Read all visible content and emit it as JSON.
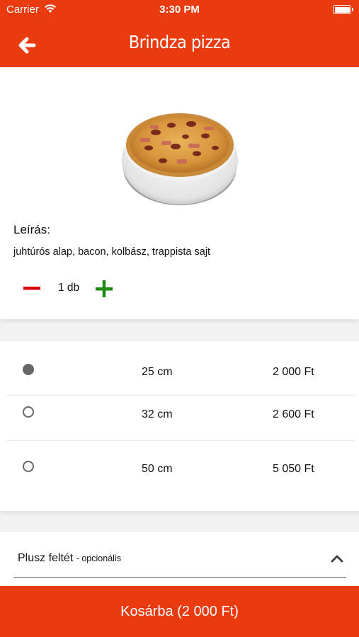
{
  "status_bar": {
    "carrier": "Carrier",
    "time": "3:30 PM"
  },
  "header": {
    "title": "Brindza pizza"
  },
  "product": {
    "description_label": "Leírás:",
    "description": "juhtúrós alap, bacon, kolbász, trappista sajt",
    "quantity": "1 db"
  },
  "sizes": [
    {
      "label": "25 cm",
      "price": "2 000 Ft",
      "selected": true
    },
    {
      "label": "32 cm",
      "price": "2 600 Ft",
      "selected": false
    },
    {
      "label": "50 cm",
      "price": "5 050 Ft",
      "selected": false
    }
  ],
  "extras": {
    "label": "Plusz feltét",
    "optional": "- opcionális"
  },
  "cart_button": "Kosárba (2 000 Ft)",
  "colors": {
    "brand": "#e93b0f",
    "minus": "#e0000a",
    "plus": "#1d8a14"
  }
}
